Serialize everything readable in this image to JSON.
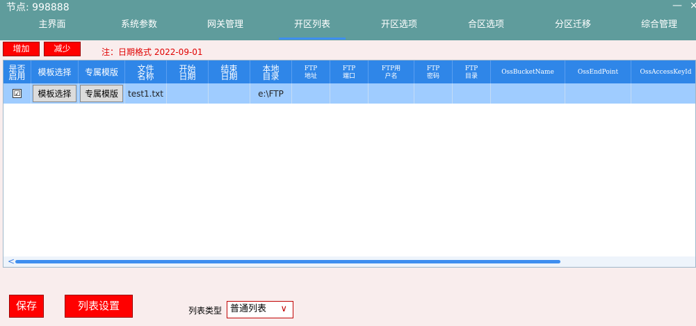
{
  "header": {
    "node_label": "节点: 998888",
    "minimize": "—",
    "close": "×",
    "tabs": [
      {
        "label": "主界面"
      },
      {
        "label": "系统参数"
      },
      {
        "label": "网关管理"
      },
      {
        "label": "开区列表",
        "active": true
      },
      {
        "label": "开区选项"
      },
      {
        "label": "合区选项"
      },
      {
        "label": "分区迁移"
      },
      {
        "label": "综合管理"
      }
    ]
  },
  "toolbar": {
    "add_label": "增加",
    "remove_label": "减少",
    "note": "注：日期格式 2022-09-01"
  },
  "table": {
    "columns": [
      {
        "label": "是否\n启用"
      },
      {
        "label": "模板选择"
      },
      {
        "label": "专属模版"
      },
      {
        "label": "文件\n名称"
      },
      {
        "label": "开始\n日期"
      },
      {
        "label": "结束\n日期"
      },
      {
        "label": "本地\n目录"
      },
      {
        "label": "FTP\n地址"
      },
      {
        "label": "FTP\n端口"
      },
      {
        "label": "FTP用\n户名"
      },
      {
        "label": "FTP\n密码"
      },
      {
        "label": "FTP\n目录"
      },
      {
        "label": "OssBucketName"
      },
      {
        "label": "OssEndPoint"
      },
      {
        "label": "OssAccessKeyId"
      }
    ],
    "rows": [
      {
        "enabled": "☑",
        "template_button": "模板选择",
        "exclusive_button": "专属模版",
        "file_name": "test1.txt",
        "start_date": "",
        "end_date": "",
        "local_dir": "e:\\FTP",
        "ftp_addr": "",
        "ftp_port": "",
        "ftp_user": "",
        "ftp_pass": "",
        "ftp_dir": "",
        "oss_bucket": "",
        "oss_endpoint": "",
        "oss_key": ""
      }
    ],
    "scroll_left": "<"
  },
  "footer": {
    "save_label": "保存",
    "list_settings_label": "列表设置",
    "list_type_label": "列表类型",
    "list_type_value": "普通列表",
    "list_type_chevron": "∨"
  },
  "colors": {
    "header_bg": "#5f9c9c",
    "table_header_bg": "#2f86e8",
    "selected_row_bg": "#9fccff",
    "button_red": "#ff0000",
    "page_bg": "#f9eded"
  }
}
